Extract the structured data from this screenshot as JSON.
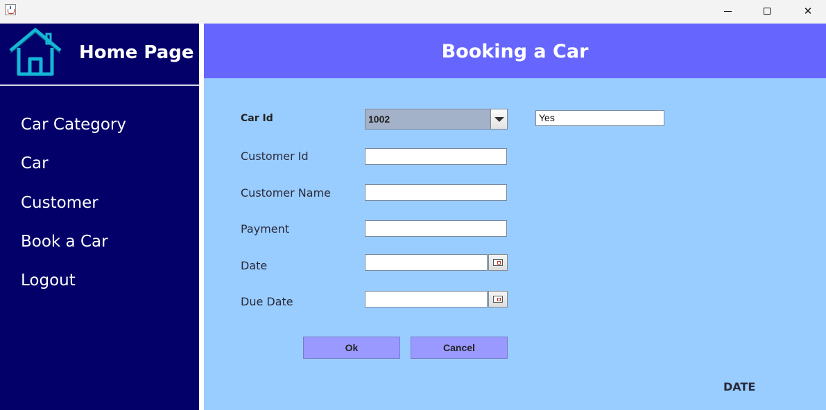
{
  "window": {
    "icon": "java-coffee-icon",
    "controls": {
      "minimize": "minimize-icon",
      "maximize": "maximize-icon",
      "close": "close-icon",
      "close_glyph": "✕"
    }
  },
  "sidebar": {
    "title": "Home Page",
    "icon": "house-icon",
    "items": [
      {
        "label": "Car Category"
      },
      {
        "label": "Car"
      },
      {
        "label": "Customer"
      },
      {
        "label": "Book a Car"
      },
      {
        "label": "Logout"
      }
    ]
  },
  "main": {
    "title": "Booking a Car",
    "form": {
      "car_id_label": "Car Id",
      "car_id_value": "1002",
      "availability_value": "Yes",
      "customer_id_label": "Customer Id",
      "customer_id_value": "",
      "customer_name_label": "Customer Name",
      "customer_name_value": "",
      "payment_label": "Payment",
      "payment_value": "",
      "date_label": "Date",
      "date_value": "",
      "due_date_label": "Due Date",
      "due_date_value": ""
    },
    "buttons": {
      "ok": "Ok",
      "cancel": "Cancel"
    },
    "date_text": "DATE"
  },
  "colors": {
    "sidebar_bg": "#030069",
    "header_bg": "#6666ff",
    "main_bg": "#99ccff",
    "button_bg": "#9999ff",
    "home_icon": "#14b8d6"
  }
}
